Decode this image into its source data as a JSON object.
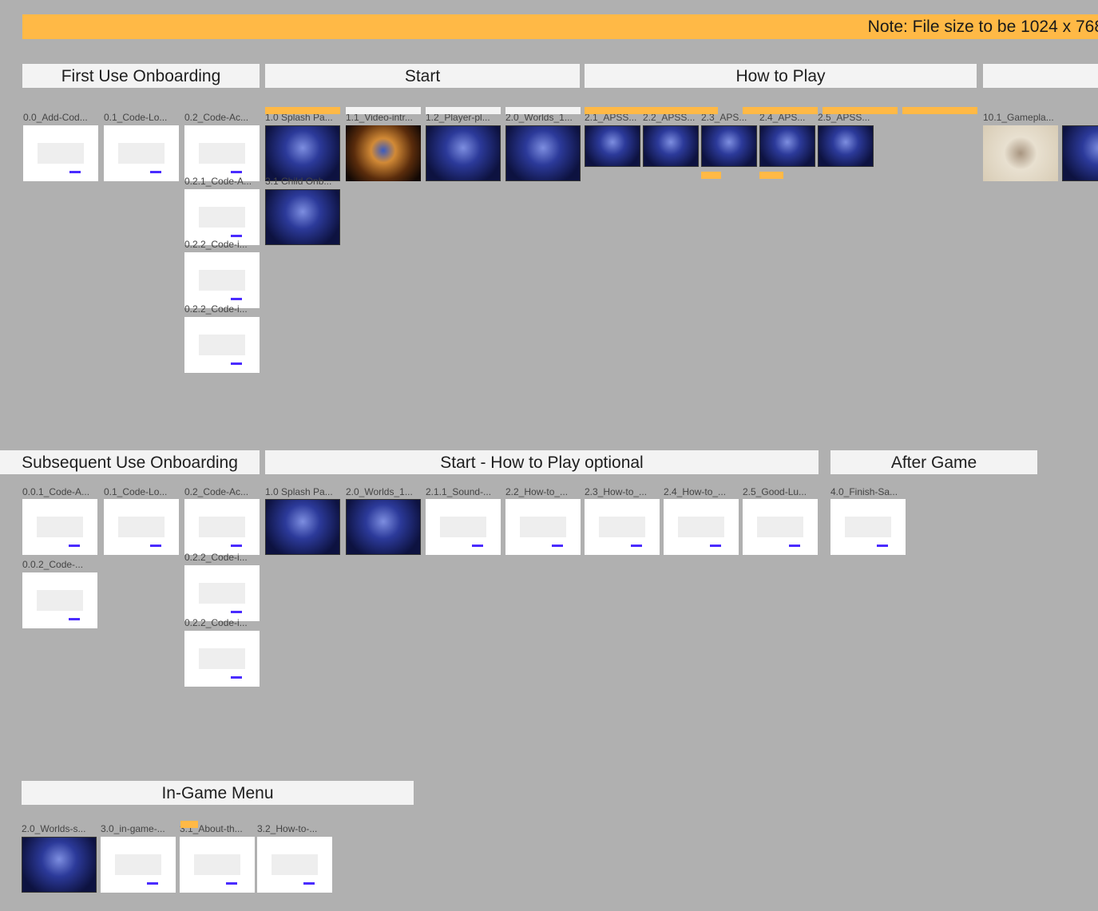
{
  "note": "Note: File size to be 1024 x 768",
  "sections": [
    "First Use Onboarding",
    "Start",
    "How to Play",
    "",
    "Subsequent Use Onboarding",
    "Start - How to Play optional",
    "After Game",
    "In-Game Menu"
  ],
  "frames": [
    {
      "label": "0.0_Add-Cod...",
      "style": "white"
    },
    {
      "label": "0.1_Code-Lo...",
      "style": "white"
    },
    {
      "label": "0.2_Code-Ac...",
      "style": "white"
    },
    {
      "label": "0.2.1_Code-A...",
      "style": "white"
    },
    {
      "label": "0.2.2_Code-i...",
      "style": "white"
    },
    {
      "label": "0.2.2_Code-i...",
      "style": "white"
    },
    {
      "label": "1.0 Splash Pa...",
      "style": "dark"
    },
    {
      "label": "3.1 Child Onb...",
      "style": "dark"
    },
    {
      "label": "1.1_Video-intr...",
      "style": "fire"
    },
    {
      "label": "1.2_Player-pl...",
      "style": "dark"
    },
    {
      "label": "2.0_Worlds_1...",
      "style": "dark"
    },
    {
      "label": "2.1_APSS...",
      "style": "dark"
    },
    {
      "label": "2.2_APSS...",
      "style": "dark"
    },
    {
      "label": "2.3_APS...",
      "style": "dark"
    },
    {
      "label": "2.4_APS...",
      "style": "dark"
    },
    {
      "label": "2.5_APSS...",
      "style": "dark"
    },
    {
      "label": "10.1_Gamepla...",
      "style": "parch"
    },
    {
      "label": "",
      "style": "dark"
    },
    {
      "label": "0.0.1_Code-A...",
      "style": "white"
    },
    {
      "label": "0.1_Code-Lo...",
      "style": "white"
    },
    {
      "label": "0.2_Code-Ac...",
      "style": "white"
    },
    {
      "label": "0.0.2_Code-...",
      "style": "white"
    },
    {
      "label": "0.2.2_Code-i...",
      "style": "white"
    },
    {
      "label": "0.2.2_Code-i...",
      "style": "white"
    },
    {
      "label": "1.0 Splash Pa...",
      "style": "dark"
    },
    {
      "label": "2.0_Worlds_1...",
      "style": "dark"
    },
    {
      "label": "2.1.1_Sound-...",
      "style": "white"
    },
    {
      "label": "2.2_How-to_...",
      "style": "white"
    },
    {
      "label": "2.3_How-to_...",
      "style": "white"
    },
    {
      "label": "2.4_How-to_...",
      "style": "white"
    },
    {
      "label": "2.5_Good-Lu...",
      "style": "white"
    },
    {
      "label": "4.0_Finish-Sa...",
      "style": "white"
    },
    {
      "label": "2.0_Worlds-s...",
      "style": "dark"
    },
    {
      "label": "3.0_in-game-...",
      "style": "white"
    },
    {
      "label": "3.1_About-th...",
      "style": "white"
    },
    {
      "label": "3.2_How-to-...",
      "style": "white"
    }
  ],
  "colors": {
    "canvas": "#b0b0b0",
    "sticky": "#ffb946",
    "header": "#f3f3f3",
    "accent": "#4a2bff"
  }
}
